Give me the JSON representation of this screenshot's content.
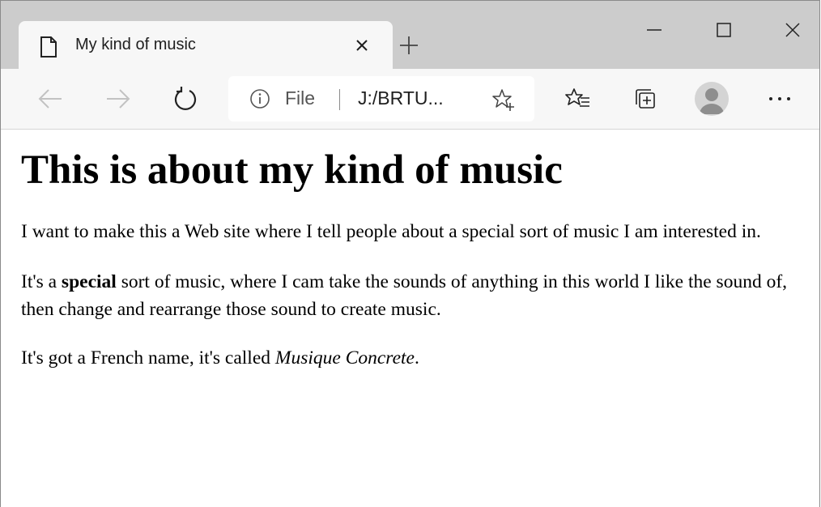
{
  "tab": {
    "title": "My kind of music",
    "icon": "page-icon"
  },
  "address_bar": {
    "scheme": "File",
    "url": "J:/BRTU..."
  },
  "page": {
    "heading": "This is about my kind of music",
    "paragraph1": "I want to make this a Web site where I tell people about a special sort of music I am interested in.",
    "paragraph2_before": "It's a ",
    "paragraph2_bold": "special",
    "paragraph2_after": " sort of music, where I cam take the sounds of anything in this world I like the sound of, then change and rearrange those sound to create music.",
    "paragraph3_before": "It's got a French name, it's called ",
    "paragraph3_italic": "Musique Concrete",
    "paragraph3_after": "."
  }
}
